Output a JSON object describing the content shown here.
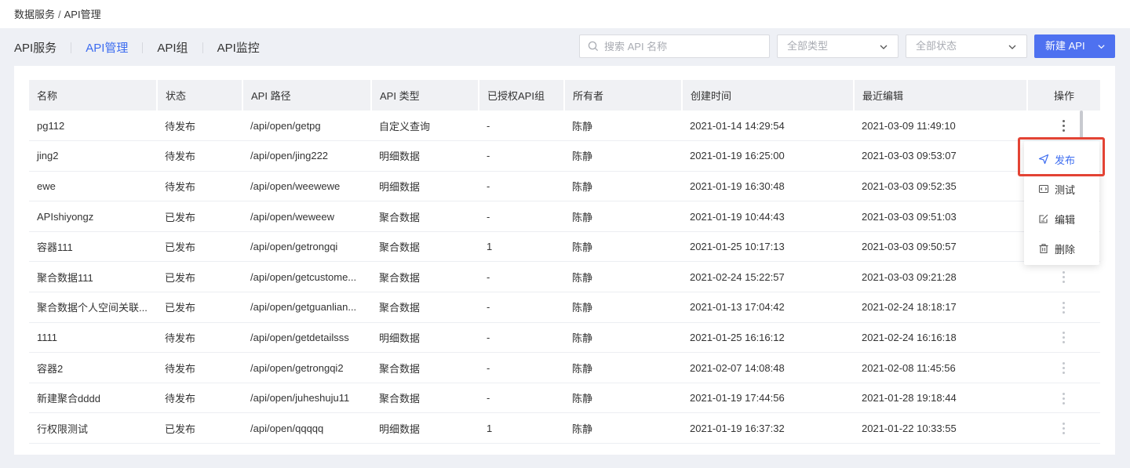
{
  "breadcrumb": {
    "root": "数据服务",
    "separator": "/",
    "current": "API管理"
  },
  "tabs": [
    {
      "label": "API服务",
      "active": false
    },
    {
      "label": "API管理",
      "active": true
    },
    {
      "label": "API组",
      "active": false
    },
    {
      "label": "API监控",
      "active": false
    }
  ],
  "search": {
    "placeholder": "搜索 API 名称",
    "value": ""
  },
  "filters": {
    "type": "全部类型",
    "status": "全部状态"
  },
  "new_button": {
    "label": "新建 API"
  },
  "table": {
    "columns": [
      "名称",
      "状态",
      "API 路径",
      "API 类型",
      "已授权API组",
      "所有者",
      "创建时间",
      "最近编辑",
      "操作"
    ],
    "rows": [
      [
        "pg112",
        "待发布",
        "/api/open/getpg",
        "自定义查询",
        "-",
        "陈静",
        "2021-01-14 14:29:54",
        "2021-03-09 11:49:10"
      ],
      [
        "jing2",
        "待发布",
        "/api/open/jing222",
        "明细数据",
        "-",
        "陈静",
        "2021-01-19 16:25:00",
        "2021-03-03 09:53:07"
      ],
      [
        "ewe",
        "待发布",
        "/api/open/weewewe",
        "明细数据",
        "-",
        "陈静",
        "2021-01-19 16:30:48",
        "2021-03-03 09:52:35"
      ],
      [
        "APIshiyongz",
        "已发布",
        "/api/open/weweew",
        "聚合数据",
        "-",
        "陈静",
        "2021-01-19 10:44:43",
        "2021-03-03 09:51:03"
      ],
      [
        "容器111",
        "已发布",
        "/api/open/getrongqi",
        "聚合数据",
        "1",
        "陈静",
        "2021-01-25 10:17:13",
        "2021-03-03 09:50:57"
      ],
      [
        "聚合数据111",
        "已发布",
        "/api/open/getcustome...",
        "聚合数据",
        "-",
        "陈静",
        "2021-02-24 15:22:57",
        "2021-03-03 09:21:28"
      ],
      [
        "聚合数据个人空间关联...",
        "已发布",
        "/api/open/getguanlian...",
        "聚合数据",
        "-",
        "陈静",
        "2021-01-13 17:04:42",
        "2021-02-24 18:18:17"
      ],
      [
        "1111",
        "待发布",
        "/api/open/getdetailsss",
        "明细数据",
        "-",
        "陈静",
        "2021-01-25 16:16:12",
        "2021-02-24 16:16:18"
      ],
      [
        "容器2",
        "待发布",
        "/api/open/getrongqi2",
        "聚合数据",
        "-",
        "陈静",
        "2021-02-07 14:08:48",
        "2021-02-08 11:45:56"
      ],
      [
        "新建聚合dddd",
        "待发布",
        "/api/open/juheshuju11",
        "聚合数据",
        "-",
        "陈静",
        "2021-01-19 17:44:56",
        "2021-01-28 19:18:44"
      ],
      [
        "行权限测试",
        "已发布",
        "/api/open/qqqqq",
        "明细数据",
        "1",
        "陈静",
        "2021-01-19 16:37:32",
        "2021-01-22 10:33:55"
      ]
    ]
  },
  "row_menu": {
    "items": [
      {
        "label": "发布",
        "icon": "send-icon"
      },
      {
        "label": "测试",
        "icon": "code-icon"
      },
      {
        "label": "编辑",
        "icon": "edit-icon"
      },
      {
        "label": "删除",
        "icon": "trash-icon"
      }
    ]
  },
  "colors": {
    "accent": "#3c6cf0",
    "primary_button": "#4e71f0",
    "highlight": "#e34334"
  }
}
